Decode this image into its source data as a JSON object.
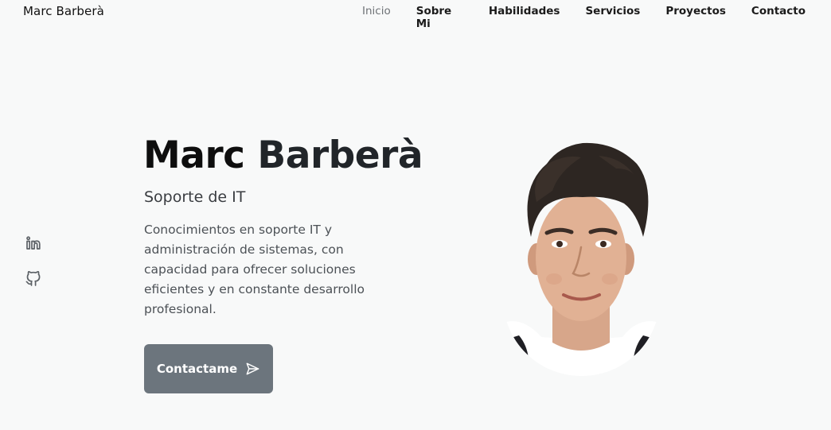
{
  "header": {
    "brand": "Marc Barberà",
    "nav": [
      "Inicio",
      "Sobre Mi",
      "Habilidades",
      "Servicios",
      "Proyectos",
      "Contacto"
    ],
    "active_index": 0
  },
  "social": [
    {
      "icon": "linkedin-icon"
    },
    {
      "icon": "github-icon"
    }
  ],
  "hero": {
    "first_name": "Marc",
    "last_name": "Barberà",
    "subtitle": "Soporte de IT",
    "description": "Conocimientos en soporte IT y administración de sistemas, con capacidad para ofrecer soluciones eficientes y en constante desarrollo profesional.",
    "cta_label": "Contactame",
    "cta_icon": "send-icon"
  },
  "colors": {
    "background": "#f8f9f9",
    "button": "#6c757d",
    "nav_active": "#6e7276"
  }
}
